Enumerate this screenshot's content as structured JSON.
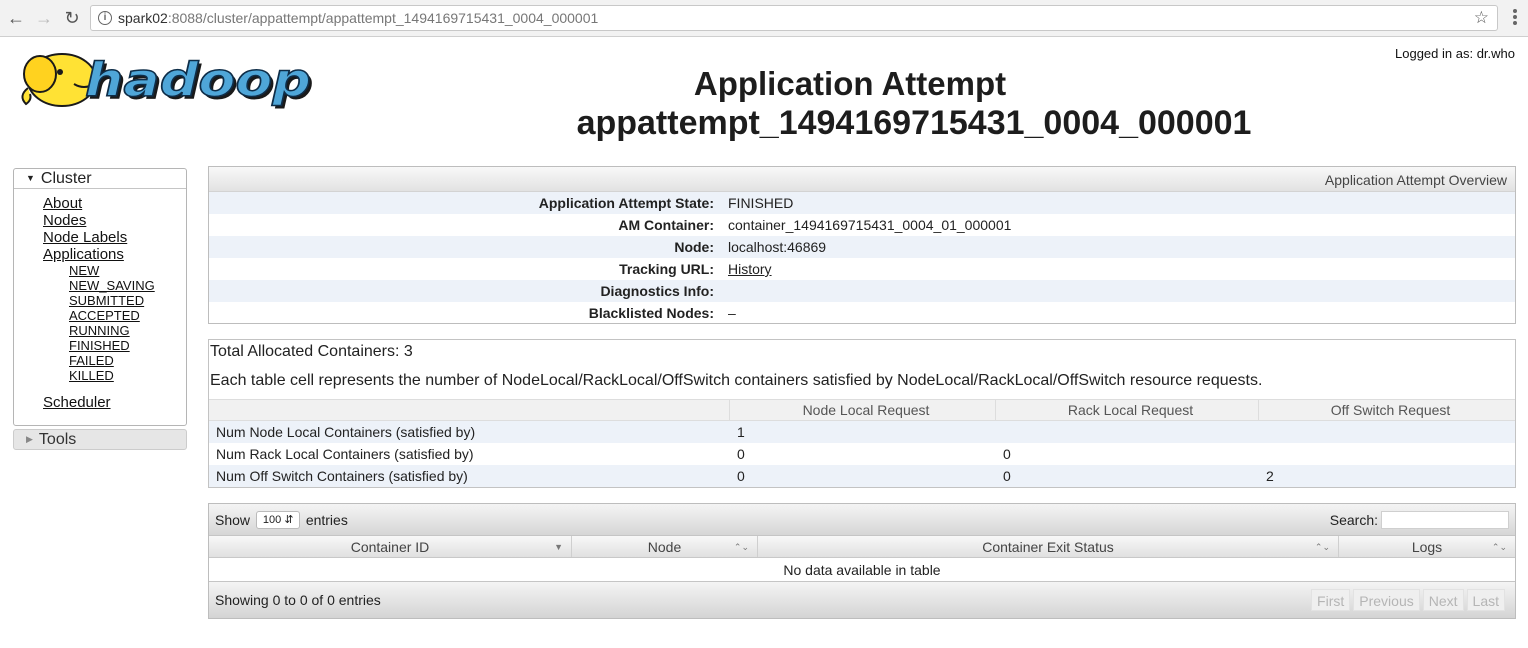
{
  "browser": {
    "url_host": "spark02",
    "url_rest": ":8088/cluster/appattempt/appattempt_1494169715431_0004_000001"
  },
  "header": {
    "logo_text": "hadoop",
    "logged_in": "Logged in as: dr.who",
    "title_line1": "Application Attempt",
    "title_line2": "appattempt_1494169715431_0004_000001"
  },
  "sidebar": {
    "cluster_label": "Cluster",
    "links": [
      "About",
      "Nodes",
      "Node Labels",
      "Applications"
    ],
    "app_states": [
      "NEW",
      "NEW_SAVING",
      "SUBMITTED",
      "ACCEPTED",
      "RUNNING",
      "FINISHED",
      "FAILED",
      "KILLED"
    ],
    "scheduler": "Scheduler",
    "tools_label": "Tools"
  },
  "overview": {
    "heading": "Application Attempt Overview",
    "rows": [
      {
        "key": "Application Attempt State:",
        "value": "FINISHED"
      },
      {
        "key": "AM Container:",
        "value": "container_1494169715431_0004_01_000001"
      },
      {
        "key": "Node:",
        "value": "localhost:46869"
      },
      {
        "key": "Tracking URL:",
        "value": "History"
      },
      {
        "key": "Diagnostics Info:",
        "value": ""
      },
      {
        "key": "Blacklisted Nodes:",
        "value": "–"
      }
    ]
  },
  "containers": {
    "total": "Total Allocated Containers: 3",
    "description": "Each table cell represents the number of NodeLocal/RackLocal/OffSwitch containers satisfied by NodeLocal/RackLocal/OffSwitch resource requests.",
    "headers": [
      "",
      "Node Local Request",
      "Rack Local Request",
      "Off Switch Request"
    ],
    "rows": [
      [
        "Num Node Local Containers (satisfied by)",
        "1",
        "",
        ""
      ],
      [
        "Num Rack Local Containers (satisfied by)",
        "0",
        "0",
        ""
      ],
      [
        "Num Off Switch Containers (satisfied by)",
        "0",
        "0",
        "2"
      ]
    ]
  },
  "datatable": {
    "show_label": "Show",
    "page_size": "100",
    "entries_label": "entries",
    "search_label": "Search:",
    "columns": [
      "Container ID",
      "Node",
      "Container Exit Status",
      "Logs"
    ],
    "empty_text": "No data available in table",
    "info": "Showing 0 to 0 of 0 entries",
    "pager": [
      "First",
      "Previous",
      "Next",
      "Last"
    ]
  }
}
